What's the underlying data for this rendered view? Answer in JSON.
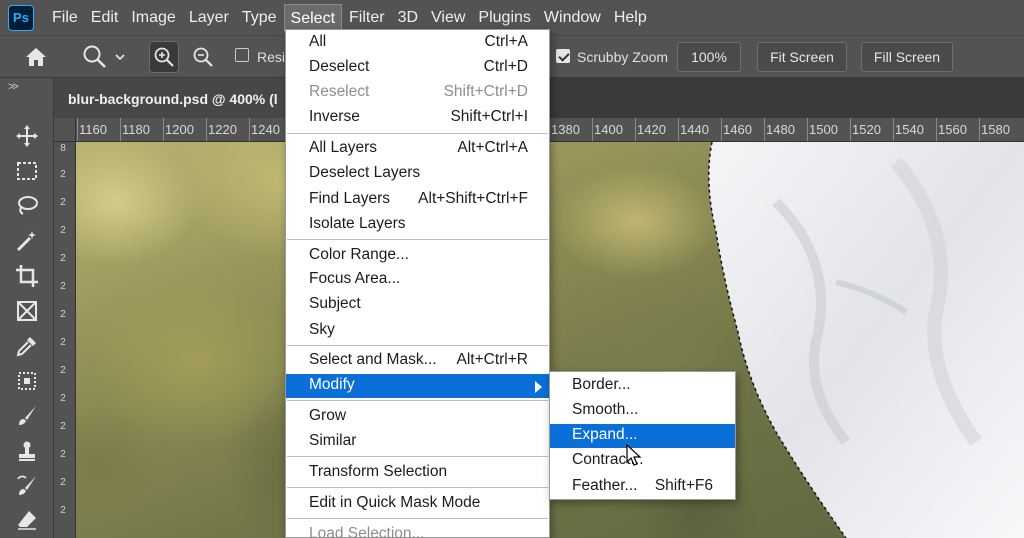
{
  "app": {
    "logo_text": "Ps"
  },
  "menubar": {
    "items": [
      "File",
      "Edit",
      "Image",
      "Layer",
      "Type",
      "Select",
      "Filter",
      "3D",
      "View",
      "Plugins",
      "Window",
      "Help"
    ],
    "active": "Select"
  },
  "options": {
    "resize_label": "Resiz",
    "resize_checked": false,
    "scrubby_label": "Scrubby Zoom",
    "scrubby_checked": true,
    "zoom_level": "100%",
    "fit_screen": "Fit Screen",
    "fill_screen": "Fill Screen"
  },
  "document": {
    "tab_title": "blur-background.psd @ 400% (l"
  },
  "ruler": {
    "top_ticks": [
      "1160",
      "1180",
      "1200",
      "1220",
      "1240",
      "1380",
      "1400",
      "1420",
      "1440",
      "1460",
      "1480",
      "1500",
      "1520",
      "1540",
      "1560",
      "1580"
    ],
    "left_ticks": [
      "8",
      "2",
      "2",
      "2",
      "2",
      "2",
      "2",
      "2",
      "2",
      "2",
      "2",
      "2",
      "2",
      "2"
    ]
  },
  "select_menu": {
    "items": [
      {
        "label": "All",
        "shortcut": "Ctrl+A"
      },
      {
        "label": "Deselect",
        "shortcut": "Ctrl+D"
      },
      {
        "label": "Reselect",
        "shortcut": "Shift+Ctrl+D",
        "disabled": true
      },
      {
        "label": "Inverse",
        "shortcut": "Shift+Ctrl+I"
      },
      {
        "label": "All Layers",
        "shortcut": "Alt+Ctrl+A"
      },
      {
        "label": "Deselect Layers",
        "shortcut": ""
      },
      {
        "label": "Find Layers",
        "shortcut": "Alt+Shift+Ctrl+F"
      },
      {
        "label": "Isolate Layers",
        "shortcut": ""
      },
      {
        "label": "Color Range...",
        "shortcut": ""
      },
      {
        "label": "Focus Area...",
        "shortcut": ""
      },
      {
        "label": "Subject",
        "shortcut": ""
      },
      {
        "label": "Sky",
        "shortcut": ""
      },
      {
        "label": "Select and Mask...",
        "shortcut": "Alt+Ctrl+R"
      },
      {
        "label": "Modify",
        "shortcut": "",
        "highlighted": true,
        "has_submenu": true
      },
      {
        "label": "Grow",
        "shortcut": ""
      },
      {
        "label": "Similar",
        "shortcut": ""
      },
      {
        "label": "Transform Selection",
        "shortcut": ""
      },
      {
        "label": "Edit in Quick Mask Mode",
        "shortcut": ""
      },
      {
        "label": "Load Selection...",
        "shortcut": "",
        "disabled": true
      }
    ]
  },
  "modify_submenu": {
    "items": [
      {
        "label": "Border...",
        "shortcut": ""
      },
      {
        "label": "Smooth...",
        "shortcut": ""
      },
      {
        "label": "Expand...",
        "shortcut": "",
        "highlighted": true
      },
      {
        "label": "Contract...",
        "shortcut": ""
      },
      {
        "label": "Feather...",
        "shortcut": "Shift+F6"
      }
    ]
  },
  "colors": {
    "menu_highlight": "#0a6fd6",
    "panel_bg": "#535353",
    "tab_bg": "#474747"
  }
}
